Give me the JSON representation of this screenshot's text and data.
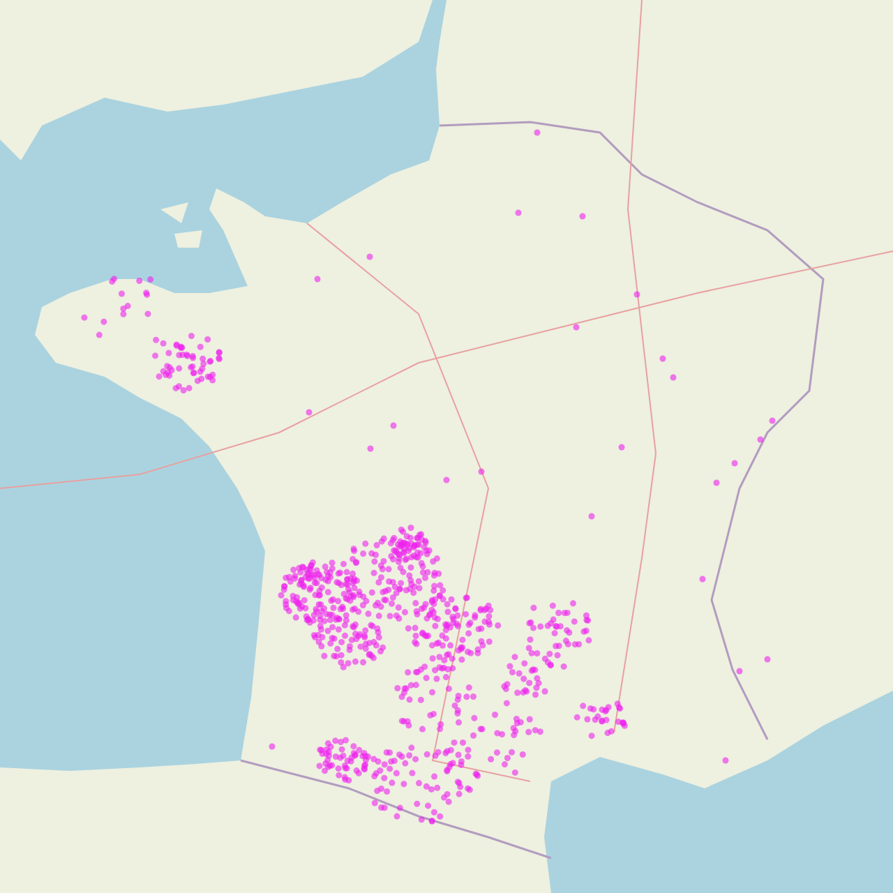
{
  "map": {
    "kind": "street-map",
    "markers_shown": true
  }
}
